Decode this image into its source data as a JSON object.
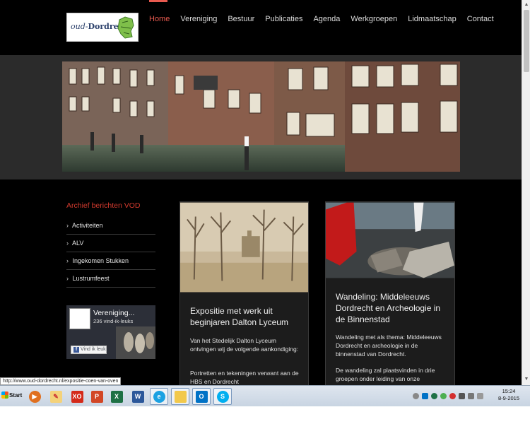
{
  "header": {
    "logo_text_prefix": "oud-",
    "logo_text_main": "Dordrecht",
    "nav": [
      {
        "label": "Home",
        "active": true
      },
      {
        "label": "Vereniging",
        "active": false
      },
      {
        "label": "Bestuur",
        "active": false
      },
      {
        "label": "Publicaties",
        "active": false
      },
      {
        "label": "Agenda",
        "active": false
      },
      {
        "label": "Werkgroepen",
        "active": false
      },
      {
        "label": "Lidmaatschap",
        "active": false
      },
      {
        "label": "Contact",
        "active": false
      }
    ]
  },
  "sidebar": {
    "title": "Archief berichten VOD",
    "items": [
      "Activiteiten",
      "ALV",
      "Ingekomen Stukken",
      "Lustrumfeest"
    ]
  },
  "facebook": {
    "name": "Vereniging...",
    "likes": "236 vind-ik-leuks",
    "button": "Vind ik leuk"
  },
  "cards": [
    {
      "title": "Expositie met werk uit beginjaren Dalton Lyceum",
      "text1": "Van het Stedelijk Dalton Lyceum ontvingen wij de volgende aankondiging:",
      "text2": "Portretten en tekeningen verwant aan de HBS en Dordrecht"
    },
    {
      "title": "Wandeling: Middeleeuws Dordrecht en Archeologie in de Binnenstad",
      "text1": "Wandeling met als thema: Middeleeuws Dordrecht en archeologie in de binnenstad van Dordrecht.",
      "text2": "De wandeling zal plaatsvinden in drie groepen onder leiding van onze deskundige stadsarcheologen"
    }
  ],
  "status_url": "http://www.oud-dordrecht.nl/expositie-coen-van-oven",
  "taskbar": {
    "start": "Start",
    "apps": [
      "media-player-icon",
      "paint-icon",
      "xo-icon",
      "powerpoint-icon",
      "excel-icon",
      "word-icon",
      "internet-explorer-icon",
      "file-explorer-icon",
      "outlook-icon",
      "skype-icon"
    ],
    "time": "15:24",
    "date": "8-9-2015"
  },
  "colors": {
    "accent": "#e85a4f",
    "sidebar_title": "#d23a2e",
    "background": "#000000"
  }
}
